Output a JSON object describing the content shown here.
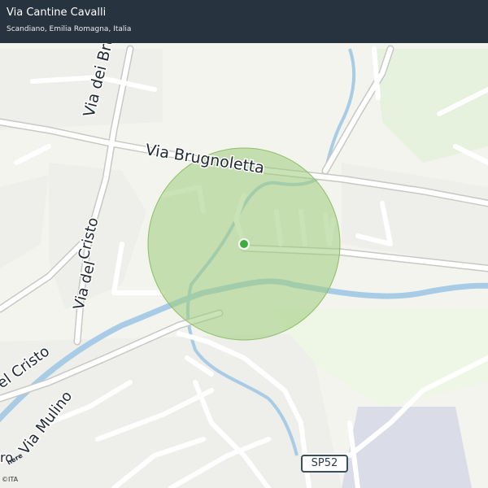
{
  "header": {
    "title": "Via Cantine Cavalli",
    "subtitle": "Scandiano, Emilia Romagna, Italia"
  },
  "map": {
    "street_labels": {
      "via_dei_brugnoli": "Via dei Brugno",
      "via_brugnoletta": "Via  Brugnoletta",
      "via_del_cristo_upper": "Cristo",
      "via_del_cristo_lower": "Via  del",
      "via_del_cristo_left": "el  Cristo",
      "via_mulino": "Via Mulino",
      "edge_fragment": "ro"
    },
    "road_shield": "SP52",
    "attribution": "©ITA",
    "logo_text": "here",
    "colors": {
      "background": "#f4f4ef",
      "park": "#e0f0d4",
      "water": "#a8cce6",
      "road": "#ffffff",
      "road_casing": "#c8c8c4",
      "location_circle": "#9fcc7a",
      "location_dot": "#3cae3c",
      "header": "#27333e"
    }
  }
}
